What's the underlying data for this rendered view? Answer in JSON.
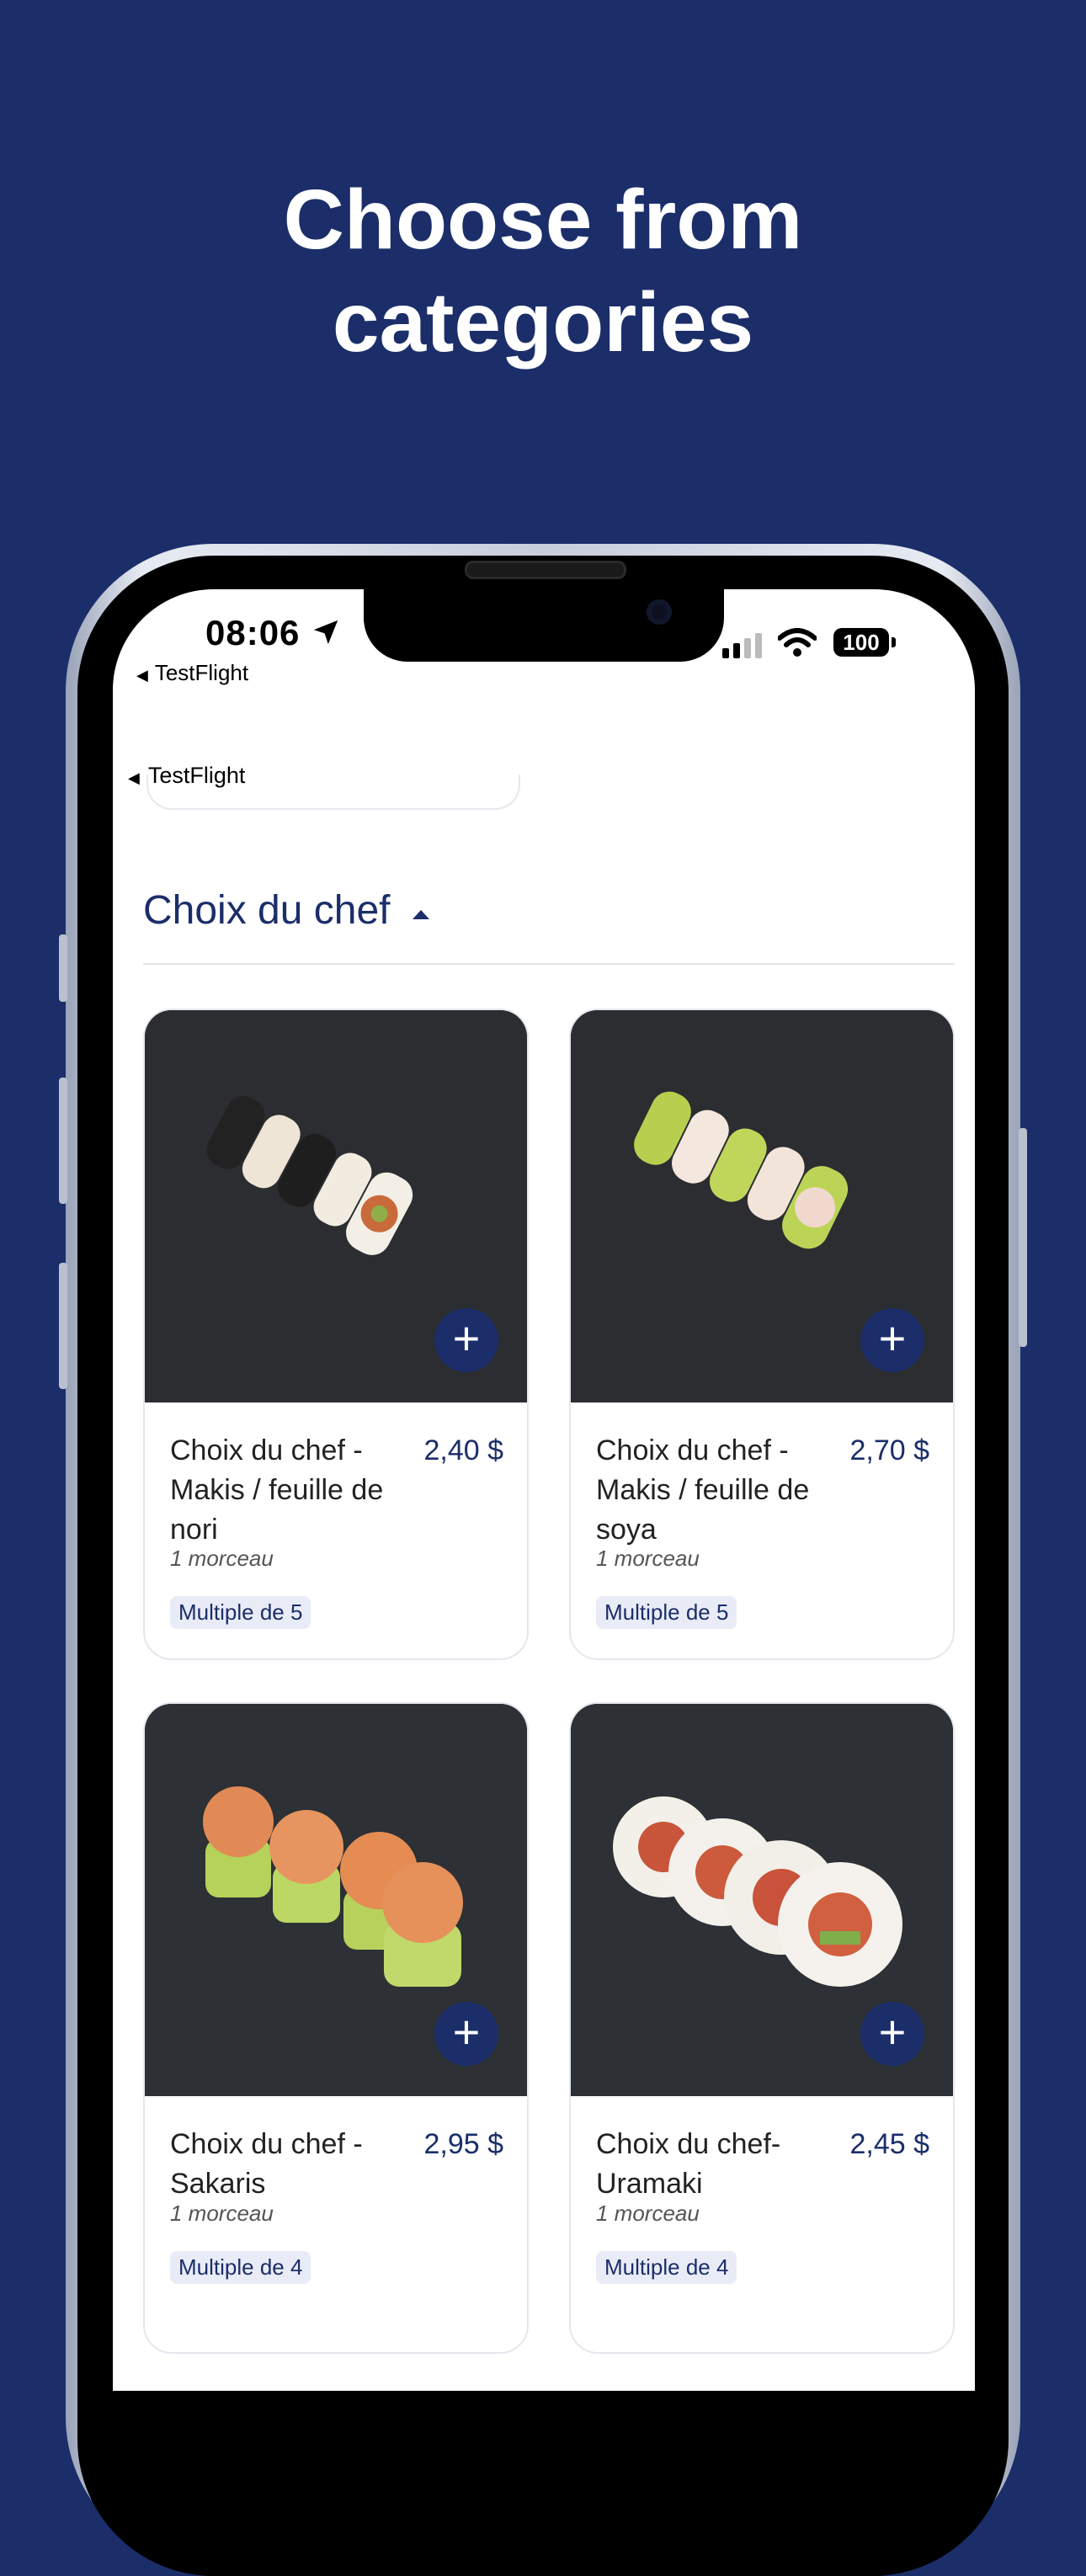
{
  "headline": {
    "line1": "Choose from",
    "line2": "categories"
  },
  "status_bar": {
    "time": "08:06",
    "back_app": "TestFlight",
    "battery": "100"
  },
  "nav": {
    "back_label": "TestFlight"
  },
  "section": {
    "title": "Choix du chef"
  },
  "products": [
    {
      "name": "Choix du chef - Makis / feuille de nori",
      "price": "2,40 $",
      "unit": "1 morceau",
      "badge": "Multiple de 5"
    },
    {
      "name": "Choix du chef - Makis / feuille de soya",
      "price": "2,70 $",
      "unit": "1 morceau",
      "badge": "Multiple de 5"
    },
    {
      "name": "Choix du chef - Sakaris",
      "price": "2,95 $",
      "unit": "1 morceau",
      "badge": "Multiple de 4"
    },
    {
      "name": "Choix du chef- Uramaki",
      "price": "2,45 $",
      "unit": "1 morceau",
      "badge": "Multiple de 4"
    }
  ],
  "colors": {
    "brand": "#1b2e6a",
    "background": "#1b2e6a"
  }
}
